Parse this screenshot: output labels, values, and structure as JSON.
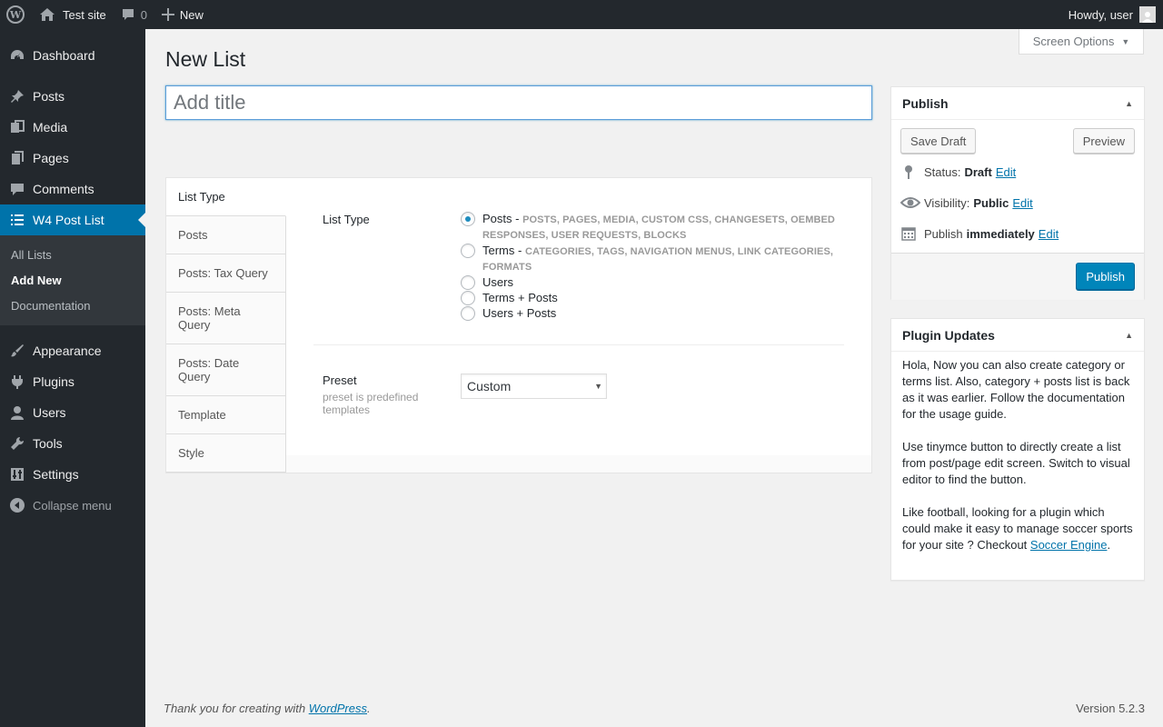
{
  "adminbar": {
    "site_name": "Test site",
    "comments_count": "0",
    "new_label": "New",
    "greeting": "Howdy, user"
  },
  "sidebar": {
    "items": [
      {
        "label": "Dashboard",
        "icon": "dashboard-icon"
      },
      {
        "label": "Posts",
        "icon": "pushpin-icon"
      },
      {
        "label": "Media",
        "icon": "media-icon"
      },
      {
        "label": "Pages",
        "icon": "pages-icon"
      },
      {
        "label": "Comments",
        "icon": "comment-bubble-icon"
      },
      {
        "label": "W4 Post List",
        "icon": "list-icon"
      }
    ],
    "submenu": [
      "All Lists",
      "Add New",
      "Documentation"
    ],
    "items_after": [
      {
        "label": "Appearance",
        "icon": "paintbrush-icon"
      },
      {
        "label": "Plugins",
        "icon": "plug-icon"
      },
      {
        "label": "Users",
        "icon": "user-icon"
      },
      {
        "label": "Tools",
        "icon": "wrench-icon"
      },
      {
        "label": "Settings",
        "icon": "sliders-icon"
      }
    ],
    "collapse_label": "Collapse menu"
  },
  "screen_options": "Screen Options",
  "page_title": "New List",
  "title_placeholder": "Add title",
  "tabs": [
    "List Type",
    "Posts",
    "Posts: Tax Query",
    "Posts: Meta Query",
    "Posts: Date Query",
    "Template",
    "Style"
  ],
  "list_type": {
    "label": "List Type",
    "options": [
      {
        "label": "Posts",
        "sep": " - ",
        "desc": "POSTS, PAGES, MEDIA, CUSTOM CSS, CHANGESETS, OEMBED RESPONSES, USER REQUESTS, BLOCKS",
        "checked": true
      },
      {
        "label": "Terms",
        "sep": " - ",
        "desc": "CATEGORIES, TAGS, NAVIGATION MENUS, LINK CATEGORIES, FORMATS",
        "checked": false
      },
      {
        "label": "Users",
        "sep": "",
        "desc": "",
        "checked": false
      },
      {
        "label": "Terms + Posts",
        "sep": "",
        "desc": "",
        "checked": false
      },
      {
        "label": "Users + Posts",
        "sep": "",
        "desc": "",
        "checked": false
      }
    ]
  },
  "preset": {
    "label": "Preset",
    "description": "preset is predefined templates",
    "value": "Custom"
  },
  "publish": {
    "title": "Publish",
    "save_draft": "Save Draft",
    "preview": "Preview",
    "status_label": "Status:",
    "status_value": "Draft",
    "visibility_label": "Visibility:",
    "visibility_value": "Public",
    "publish_label": "Publish",
    "publish_value": "immediately",
    "edit_label": "Edit",
    "publish_button": "Publish"
  },
  "plugin_updates": {
    "title": "Plugin Updates",
    "para1": "Hola, Now you can also create category or terms list. Also, category + posts list is back as it was earlier. Follow the documentation for the usage guide.",
    "para2": "Use tinymce button to directly create a list from post/page edit screen. Switch to visual editor to find the button.",
    "para3_prefix": "Like football, looking for a plugin which could make it easy to manage soccer sports for your site ? Checkout ",
    "para3_link": "Soccer Engine",
    "para3_suffix": "."
  },
  "footer": {
    "thanks_prefix": "Thank you for creating with ",
    "thanks_link": "WordPress",
    "thanks_suffix": ".",
    "version": "Version 5.2.3"
  }
}
